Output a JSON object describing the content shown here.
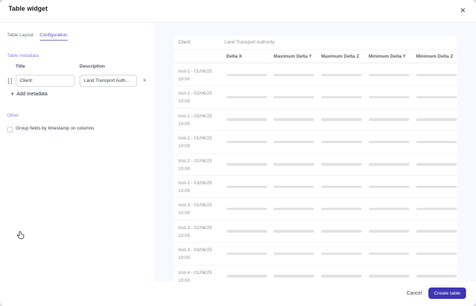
{
  "dialog": {
    "title": "Table widget"
  },
  "tabs": [
    {
      "label": "Table Layout",
      "active": false
    },
    {
      "label": "Configuration",
      "active": true
    }
  ],
  "config": {
    "section_metadata": "Table metadata",
    "title_label": "Title",
    "description_label": "Description",
    "metadata_rows": [
      {
        "title": "Client:",
        "description": "Land Transport Auth..."
      }
    ],
    "add_metadata_label": "Add metadata",
    "section_other": "Other",
    "group_checkbox_label": "Group fields by timestamp on columns",
    "group_checkbox_checked": false
  },
  "preview": {
    "client_label": "Client:",
    "client_value": "Land Transport Authority",
    "columns": [
      "Delta X",
      "Maximum Delta Y",
      "Maximum Delta Z",
      "Minimum Delta Y",
      "Minimum Delta Z"
    ],
    "rows": [
      {
        "name": "Inst-1 - 01/06/25",
        "time": "10:00"
      },
      {
        "name": "Inst-1 - 02/06/25",
        "time": "10:00"
      },
      {
        "name": "Inst-1 - 03/06/25",
        "time": "10:00"
      },
      {
        "name": "Inst-2 - 01/06/25",
        "time": "10:00"
      },
      {
        "name": "Inst-2 - 02/06/25",
        "time": "10:00"
      },
      {
        "name": "Inst-2 - 03/06/25",
        "time": "10:00"
      },
      {
        "name": "Inst-3 - 01/06/25",
        "time": "10:00"
      },
      {
        "name": "Inst-3 - 02/06/25",
        "time": "10:00"
      },
      {
        "name": "Inst-3 - 03/06/25",
        "time": "10:00"
      },
      {
        "name": "Inst-4 - 01/06/25",
        "time": "10:00"
      }
    ]
  },
  "footer": {
    "cancel_label": "Cancel",
    "create_label": "Create table"
  },
  "colors": {
    "accent": "#453cba",
    "panel_bg": "#f8f9fe",
    "bar": "#e2e2e4"
  }
}
